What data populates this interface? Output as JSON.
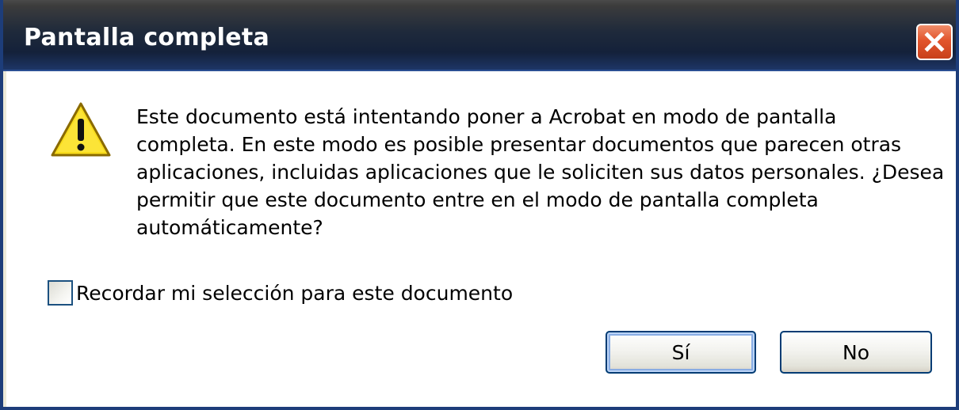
{
  "window": {
    "title": "Pantalla completa",
    "close_icon": "close-icon",
    "titlebar_color": "#1f2a3b",
    "close_color": "#e2552d"
  },
  "dialog": {
    "icon": "warning-icon",
    "message_lines": [
      "Este documento está intentando poner a Acrobat en modo de pantalla",
      "completa. En este modo es posible presentar documentos que parecen otras",
      "aplicaciones, incluidas aplicaciones que le soliciten sus datos personales. ¿Desea",
      "permitir que este documento entre en el modo de pantalla completa",
      "automáticamente?"
    ],
    "remember_label": "Recordar mi selección para este documento",
    "remember_checked": false
  },
  "buttons": {
    "yes_label": "Sí",
    "no_label": "No",
    "default": "yes"
  }
}
